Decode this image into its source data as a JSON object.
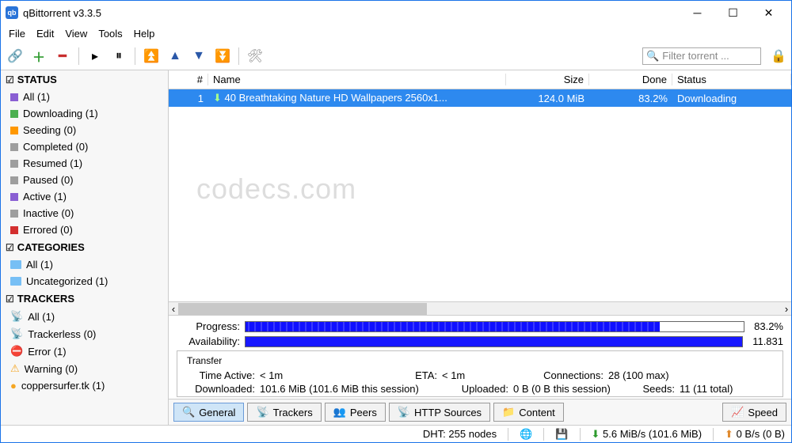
{
  "title": "qBittorrent v3.3.5",
  "menu": [
    "File",
    "Edit",
    "View",
    "Tools",
    "Help"
  ],
  "filter_placeholder": "Filter torrent ...",
  "sidebar": {
    "status_h": "STATUS",
    "status": [
      {
        "color": "#8a5fd3",
        "label": "All (1)"
      },
      {
        "color": "#4caf50",
        "label": "Downloading (1)"
      },
      {
        "color": "#ff9800",
        "label": "Seeding (0)"
      },
      {
        "color": "#9e9e9e",
        "label": "Completed (0)"
      },
      {
        "color": "#9e9e9e",
        "label": "Resumed (1)"
      },
      {
        "color": "#9e9e9e",
        "label": "Paused (0)"
      },
      {
        "color": "#8a5fd3",
        "label": "Active (1)"
      },
      {
        "color": "#9e9e9e",
        "label": "Inactive (0)"
      },
      {
        "color": "#d32f2f",
        "label": "Errored (0)"
      }
    ],
    "cat_h": "CATEGORIES",
    "cats": [
      "All (1)",
      "Uncategorized (1)"
    ],
    "trk_h": "TRACKERS",
    "trks": [
      {
        "icon": "net",
        "label": "All (1)"
      },
      {
        "icon": "net",
        "label": "Trackerless (0)"
      },
      {
        "icon": "err",
        "label": "Error (1)"
      },
      {
        "icon": "warn",
        "label": "Warning (0)"
      },
      {
        "icon": "dot",
        "label": "coppersurfer.tk (1)"
      }
    ]
  },
  "columns": {
    "num": "#",
    "name": "Name",
    "size": "Size",
    "done": "Done",
    "status": "Status"
  },
  "row": {
    "num": "1",
    "name": "40 Breathtaking Nature HD Wallpapers 2560x1...",
    "size": "124.0 MiB",
    "done": "83.2%",
    "status": "Downloading"
  },
  "watermark": "codecs.com",
  "details": {
    "progress_lbl": "Progress:",
    "progress_pct": "83.2%",
    "progress_w": "83.2%",
    "avail_lbl": "Availability:",
    "avail_val": "11.831",
    "transfer_lbl": "Transfer",
    "time_active_lbl": "Time Active:",
    "time_active": "< 1m",
    "eta_lbl": "ETA:",
    "eta": "< 1m",
    "conn_lbl": "Connections:",
    "conn": "28 (100 max)",
    "dl_lbl": "Downloaded:",
    "dl": "101.6 MiB (101.6 MiB this session)",
    "ul_lbl": "Uploaded:",
    "ul": "0 B (0 B this session)",
    "seeds_lbl": "Seeds:",
    "seeds": "11 (11 total)"
  },
  "tabs": [
    "General",
    "Trackers",
    "Peers",
    "HTTP Sources",
    "Content"
  ],
  "speed_tab": "Speed",
  "status": {
    "dht": "DHT: 255 nodes",
    "down": "5.6 MiB/s (101.6 MiB)",
    "up": "0 B/s (0 B)"
  }
}
